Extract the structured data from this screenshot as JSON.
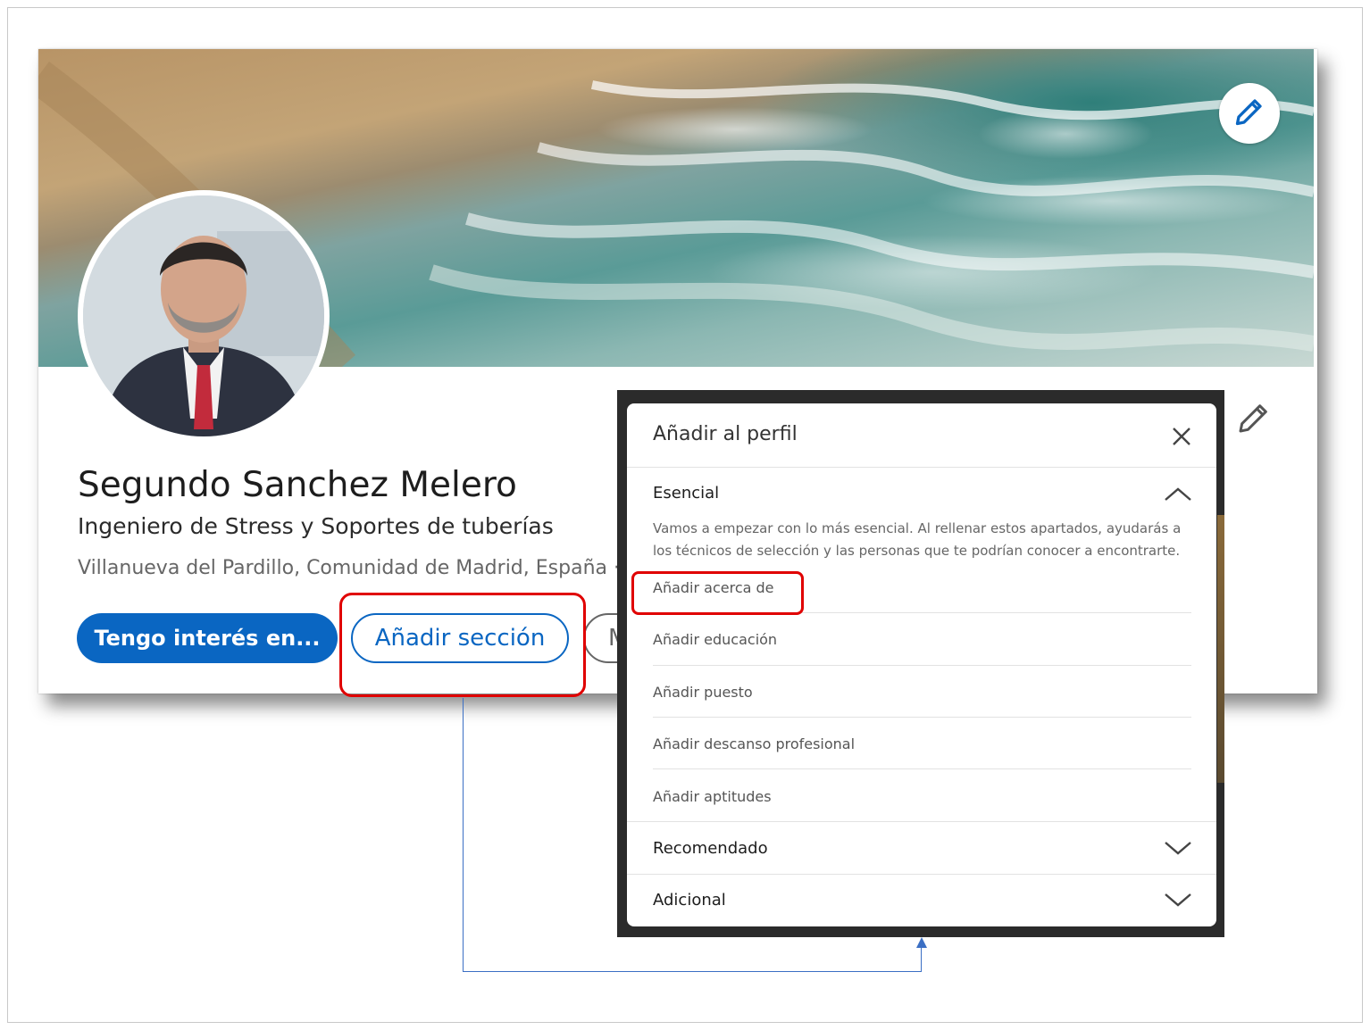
{
  "profile": {
    "name": "Segundo Sanchez Melero",
    "headline": "Ingeniero de Stress y Soportes de tuberías",
    "location": "Villanueva del Pardillo, Comunidad de Madrid, España ·",
    "buttons": {
      "primary": "Tengo interés en...",
      "secondary": "Añadir sección",
      "more": "M"
    },
    "colors": {
      "accent": "#0a66c2",
      "highlight": "#e00000",
      "connector": "#3b6fc4"
    }
  },
  "dialog": {
    "title": "Añadir al perfil",
    "sections": [
      {
        "label": "Esencial",
        "expanded": true,
        "description": "Vamos a empezar con lo más esencial. Al rellenar estos apartados, ayudarás a los técnicos de selección y las personas que te podrían conocer a encontrarte.",
        "items": [
          "Añadir acerca de",
          "Añadir educación",
          "Añadir puesto",
          "Añadir descanso profesional",
          "Añadir aptitudes"
        ]
      },
      {
        "label": "Recomendado",
        "expanded": false
      },
      {
        "label": "Adicional",
        "expanded": false
      }
    ]
  },
  "icons": {
    "banner_edit": "pencil-icon",
    "card_edit": "pencil-icon",
    "close": "close-icon",
    "expand": "chevron-up-icon",
    "collapse": "chevron-down-icon"
  }
}
